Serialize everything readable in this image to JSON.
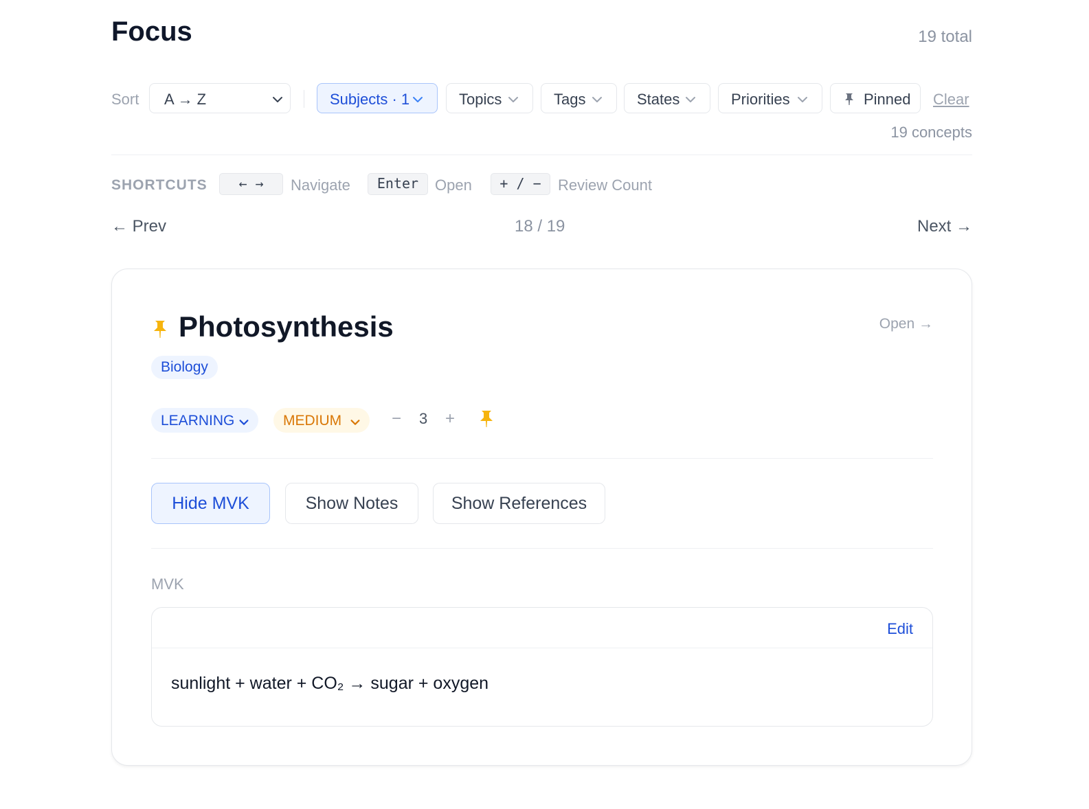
{
  "page": {
    "title": "Focus",
    "total": "19 total"
  },
  "filters": {
    "sort_label": "Sort",
    "sort_value": "A → Z",
    "subjects": "Subjects · 1",
    "topics": "Topics",
    "tags": "Tags",
    "states": "States",
    "priorities": "Priorities",
    "pinned": "Pinned",
    "clear": "Clear",
    "concepts_count": "19 concepts"
  },
  "shortcuts": {
    "title": "SHORTCUTS",
    "items": [
      {
        "keys": "←  →",
        "label": "Navigate"
      },
      {
        "keys": "Enter",
        "label": "Open"
      },
      {
        "keys": "+ / −",
        "label": "Review Count"
      }
    ]
  },
  "pager": {
    "prev": "← Prev",
    "position": "18 / 19",
    "next": "Next →"
  },
  "concept": {
    "title": "Photosynthesis",
    "open": "Open →",
    "subject": "Biology",
    "state": "LEARNING",
    "priority": "MEDIUM",
    "review_minus": "−",
    "review_count": "3",
    "review_plus": "+",
    "buttons": {
      "mvk": "Hide MVK",
      "notes": "Show Notes",
      "references": "Show References"
    },
    "mvk": {
      "label": "MVK",
      "edit": "Edit",
      "text": "sunlight + water + CO₂ → sugar + oxygen"
    }
  },
  "colors": {
    "accent": "#1d4ed8",
    "pin": "#f6b40e",
    "priority": "#d97706"
  }
}
